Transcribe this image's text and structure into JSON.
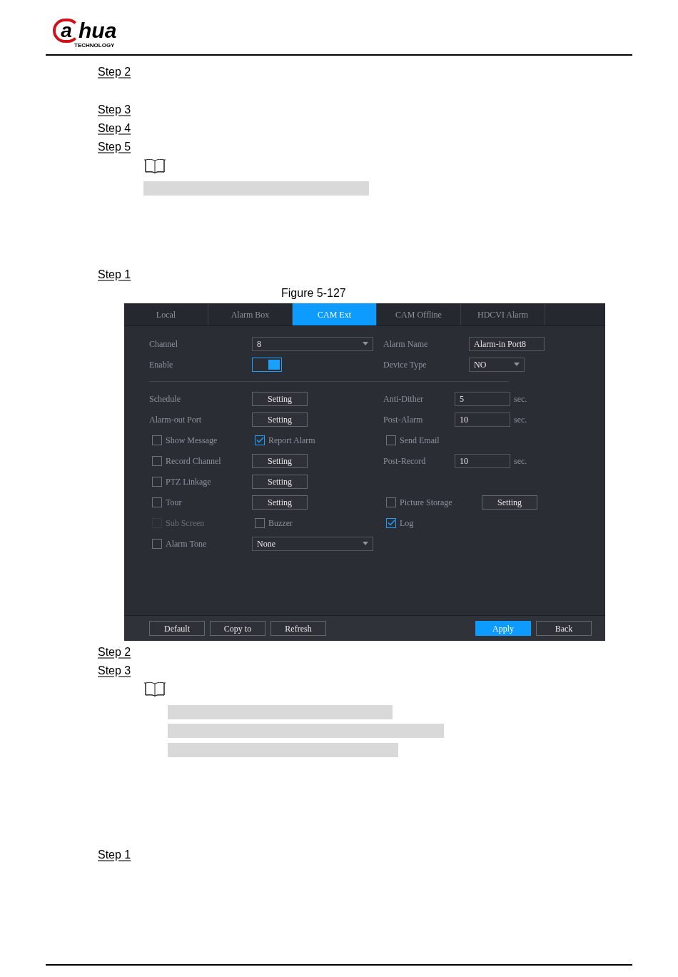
{
  "header": {
    "logo_mark": "a",
    "logo_word": "hua",
    "logo_tagline": "TECHNOLOGY"
  },
  "blocks": [
    {
      "kind": "step",
      "text": "Step 2"
    },
    {
      "kind": "step",
      "text": "Step 3"
    },
    {
      "kind": "step",
      "text": "Step 4"
    },
    {
      "kind": "step",
      "text": "Step 5"
    },
    {
      "kind": "note"
    },
    {
      "kind": "highlight"
    },
    {
      "kind": "step",
      "text": "Step 1"
    },
    {
      "kind": "caption",
      "text": "Figure 5-127"
    },
    {
      "kind": "screen"
    },
    {
      "kind": "step",
      "text": "Step 2"
    },
    {
      "kind": "step",
      "text": "Step 3"
    },
    {
      "kind": "note"
    },
    {
      "kind": "highlight"
    },
    {
      "kind": "highlight"
    },
    {
      "kind": "highlight"
    },
    {
      "kind": "step",
      "text": "Step 1"
    }
  ],
  "screen": {
    "tabs": [
      {
        "label": "Local",
        "selected": false
      },
      {
        "label": "Alarm Box",
        "selected": false
      },
      {
        "label": "CAM Ext",
        "selected": true
      },
      {
        "label": "CAM Offline",
        "selected": false
      },
      {
        "label": "HDCVI Alarm",
        "selected": false
      }
    ],
    "rows": [
      {
        "kind": "row",
        "left": {
          "kind": "label",
          "text": "Channel"
        },
        "mid": {
          "kind": "select",
          "value": "8"
        },
        "right_label": {
          "kind": "label",
          "text": "Alarm Name"
        },
        "right": {
          "kind": "field",
          "value": "Alarm-in Port8"
        }
      },
      {
        "kind": "row",
        "left": {
          "kind": "label",
          "text": "Enable"
        },
        "mid": {
          "kind": "toggle",
          "on": true
        },
        "right_label": {
          "kind": "label",
          "text": "Device Type"
        },
        "right": {
          "kind": "select",
          "value": "NO"
        }
      },
      {
        "kind": "divider"
      },
      {
        "kind": "row",
        "left": {
          "kind": "label",
          "text": "Schedule"
        },
        "mid": {
          "kind": "button",
          "label": "Setting"
        },
        "right_label": {
          "kind": "label",
          "text": "Anti-Dither"
        },
        "right": {
          "kind": "field",
          "value": "5"
        },
        "unit": "sec."
      },
      {
        "kind": "row",
        "left": {
          "kind": "label",
          "text": "Alarm-out Port"
        },
        "mid": {
          "kind": "button",
          "label": "Setting"
        },
        "right_label": {
          "kind": "label",
          "text": "Post-Alarm"
        },
        "right": {
          "kind": "field",
          "value": "10"
        },
        "unit": "sec."
      },
      {
        "kind": "row",
        "left": {
          "kind": "checkbox",
          "text": "Show Message",
          "checked": false,
          "disabled": false
        },
        "mid": {
          "kind": "checkbox",
          "text": "Report Alarm",
          "checked": true,
          "disabled": false
        },
        "right_label": {
          "kind": "checkbox",
          "text": "Send Email",
          "checked": false,
          "disabled": false
        }
      },
      {
        "kind": "row",
        "left": {
          "kind": "checkbox",
          "text": "Record Channel",
          "checked": false,
          "disabled": false
        },
        "mid": {
          "kind": "button",
          "label": "Setting"
        },
        "right_label": {
          "kind": "label",
          "text": "Post-Record"
        },
        "right": {
          "kind": "field",
          "value": "10"
        },
        "unit": "sec."
      },
      {
        "kind": "row",
        "left": {
          "kind": "checkbox",
          "text": "PTZ Linkage",
          "checked": false,
          "disabled": false
        },
        "mid": {
          "kind": "button",
          "label": "Setting"
        }
      },
      {
        "kind": "row",
        "left": {
          "kind": "checkbox",
          "text": "Tour",
          "checked": false,
          "disabled": false
        },
        "mid": {
          "kind": "button",
          "label": "Setting"
        },
        "right_label": {
          "kind": "checkbox",
          "text": "Picture Storage",
          "checked": false,
          "disabled": false
        },
        "right": {
          "kind": "button",
          "label": "Setting"
        }
      },
      {
        "kind": "row",
        "left": {
          "kind": "checkbox",
          "text": "Sub Screen",
          "checked": false,
          "disabled": true
        },
        "mid": {
          "kind": "checkbox",
          "text": "Buzzer",
          "checked": false,
          "disabled": false
        },
        "right_label": {
          "kind": "checkbox",
          "text": "Log",
          "checked": true,
          "disabled": false
        }
      },
      {
        "kind": "row",
        "left": {
          "kind": "checkbox",
          "text": "Alarm Tone",
          "checked": false,
          "disabled": false
        },
        "mid": {
          "kind": "select",
          "value": "None"
        }
      }
    ],
    "footer_left": [
      {
        "label": "Default",
        "kind": "default"
      },
      {
        "label": "Copy to",
        "kind": "default"
      },
      {
        "label": "Refresh",
        "kind": "default"
      }
    ],
    "footer_right": [
      {
        "label": "Apply",
        "kind": "primary"
      },
      {
        "label": "Back",
        "kind": "default"
      }
    ]
  }
}
